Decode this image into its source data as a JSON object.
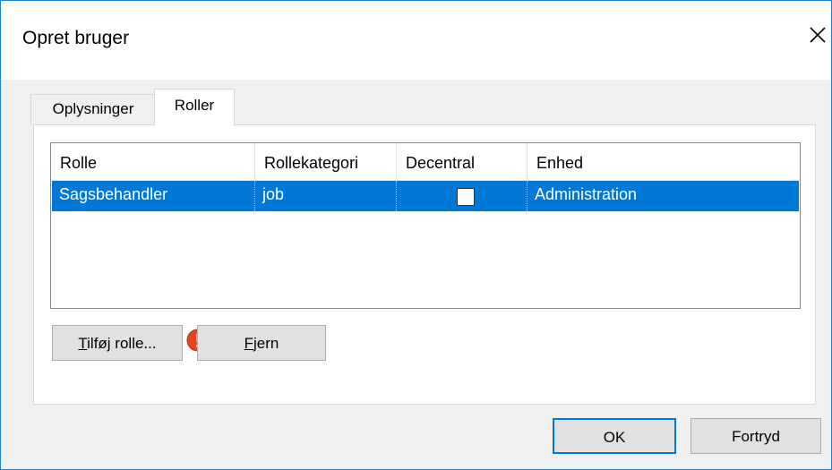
{
  "dialog": {
    "title": "Opret bruger",
    "close_glyph": "×"
  },
  "tabs": [
    {
      "label": "Oplysninger",
      "active": false
    },
    {
      "label": "Roller",
      "active": true
    }
  ],
  "table": {
    "columns": [
      "Rolle",
      "Rollekategori",
      "Decentral",
      "Enhed"
    ],
    "rows": [
      {
        "rolle": "Sagsbehandler",
        "rollekategori": "job",
        "decentral": false,
        "enhed": "Administration",
        "selected": true
      }
    ]
  },
  "buttons": {
    "add_role_prefix": "T",
    "add_role_rest": "ilføj rolle...",
    "remove_prefix": "F",
    "remove_rest": "jern",
    "ok": "OK",
    "cancel": "Fortryd"
  },
  "colors": {
    "accent": "#0078d7",
    "warning": "#e8431f"
  },
  "icons": {
    "close": "close-icon",
    "warning": "warning-icon"
  }
}
